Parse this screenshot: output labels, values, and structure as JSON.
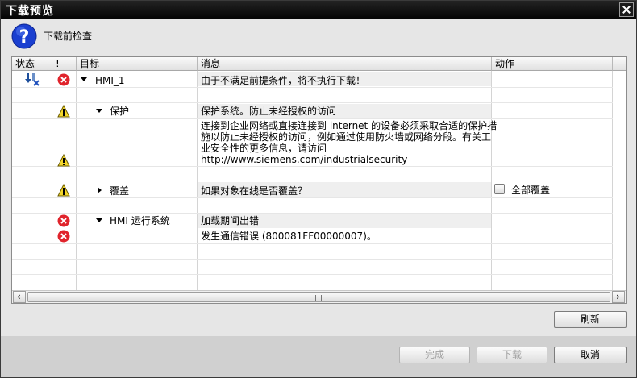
{
  "window": {
    "title": "下载预览",
    "close_icon": "close-icon"
  },
  "header": {
    "icon": "question-icon",
    "text": "下载前检查"
  },
  "grid": {
    "columns": [
      "状态",
      "!",
      "目标",
      "消息",
      "动作"
    ],
    "rows": [
      {
        "status_icon": "download-error-icon",
        "severity": "error",
        "target": "HMI_1",
        "expand": "expanded",
        "message": "由于不满足前提条件，将不执行下载！"
      },
      {
        "severity": "warning",
        "target": "保护",
        "expand": "expanded",
        "message": "保护系统。防止未经授权的访问"
      },
      {
        "severity": "warning",
        "target": "",
        "message": "连接到企业网络或直接连接到 internet 的设备必须采取合适的保护措施以防止未经授权的访问，例如通过使用防火墙或网络分段。有关工业安全性的更多信息，请访问 http://www.siemens.com/industrialsecurity"
      },
      {
        "severity": "warning",
        "target": "覆盖",
        "expand": "collapsed",
        "message": "如果对象在线是否覆盖？",
        "action": {
          "checkbox_label": "全部覆盖",
          "checked": false
        }
      },
      {
        "severity": "error",
        "target": "HMI 运行系统",
        "expand": "expanded",
        "message": "加载期间出错"
      },
      {
        "severity": "error",
        "target": "",
        "message": "发生通信错误 (800081FF00000007)。"
      }
    ]
  },
  "buttons": {
    "refresh": "刷新",
    "finish": "完成",
    "load": "下载",
    "cancel": "取消"
  },
  "colors": {
    "error": "#e0242c",
    "warning": "#f3d62a",
    "titlebar": "#0a0a0a",
    "question": "#1a3fd0"
  }
}
